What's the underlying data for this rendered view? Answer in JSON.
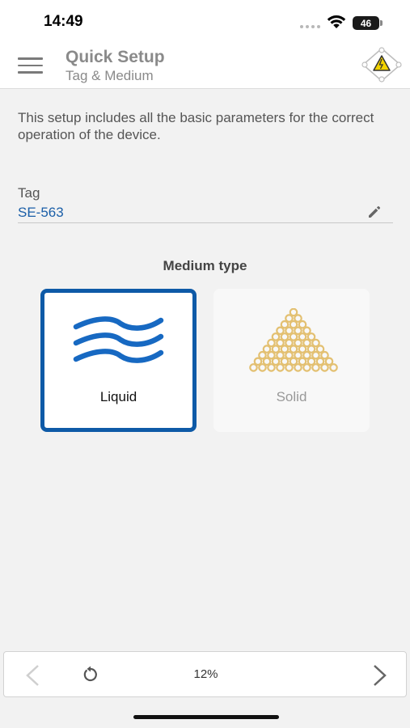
{
  "status_bar": {
    "time": "14:49",
    "battery": "46"
  },
  "header": {
    "title": "Quick Setup",
    "subtitle": "Tag & Medium"
  },
  "intro_text": "This setup includes all the basic parameters for the correct operation of the device.",
  "tag": {
    "label": "Tag",
    "value": "SE-563"
  },
  "medium": {
    "title": "Medium type",
    "options": [
      {
        "label": "Liquid",
        "selected": true,
        "icon": "waves-icon"
      },
      {
        "label": "Solid",
        "selected": false,
        "icon": "solid-pile-icon"
      }
    ]
  },
  "footer": {
    "progress": "12%"
  },
  "colors": {
    "accent": "#0e5aa7",
    "tag_value": "#1b5fa8",
    "solid_icon": "#e3c071"
  }
}
